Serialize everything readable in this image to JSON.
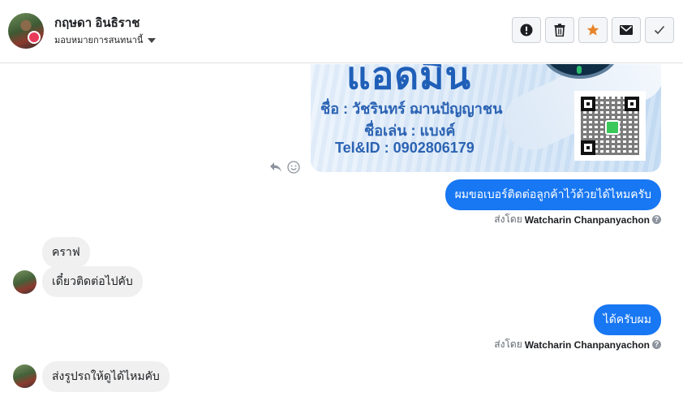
{
  "header": {
    "contact_name": "กฤษดา อินธิราช",
    "assign_label": "มอบหมายการสนทนานี้",
    "actions": [
      {
        "name": "spam-button",
        "icon": "exclamation-circle-icon"
      },
      {
        "name": "delete-button",
        "icon": "trash-icon"
      },
      {
        "name": "star-button",
        "icon": "star-icon",
        "color": "#e8842a"
      },
      {
        "name": "email-button",
        "icon": "envelope-icon"
      },
      {
        "name": "done-button",
        "icon": "check-icon"
      }
    ]
  },
  "image_card": {
    "big_text": "แอดมิน",
    "name_line": "ชื่อ : วัชรินทร์ ฌานปัญญาชน",
    "nick_line": "ชื่อเล่น : แบงค์",
    "tel_line": "Tel&ID : 0902806179"
  },
  "messages": [
    {
      "side": "out",
      "text": "ผมขอเบอร์ติดต่อลูกค้าไว้ด้วยได้ไหมครับ"
    },
    {
      "side": "in",
      "text": "คราฟ"
    },
    {
      "side": "in",
      "text": "เดี๋ยวติดต่อไปคับ"
    },
    {
      "side": "out",
      "text": "ได้ครับผม"
    },
    {
      "side": "in",
      "text": "ส่งรูปรถให้ดูได้ไหมคับ"
    }
  ],
  "sent_by": {
    "prefix": "ส่งโดย",
    "name": "Watcharin Chanpanyachon",
    "help": "?"
  },
  "colors": {
    "brand_blue": "#1877f2",
    "incoming_bubble": "#f0f0f0",
    "star": "#e8842a"
  }
}
